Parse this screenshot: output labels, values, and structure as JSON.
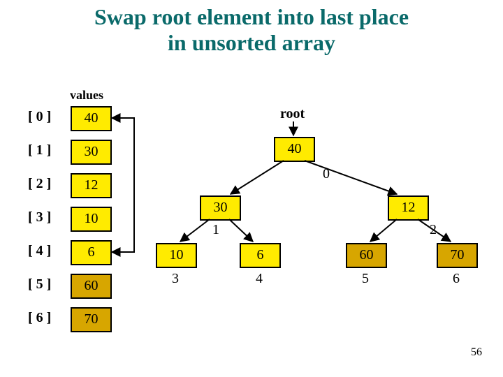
{
  "title_line1": "Swap root element into last place",
  "title_line2": "in unsorted array",
  "values_label": "values",
  "indices": [
    "[ 0 ]",
    "[ 1 ]",
    "[ 2 ]",
    "[ 3 ]",
    "[ 4 ]",
    "[ 5 ]",
    "[ 6 ]"
  ],
  "cells": [
    "40",
    "30",
    "12",
    "10",
    "6",
    "60",
    "70"
  ],
  "root_label": "root",
  "tree": {
    "n0": {
      "value": "40",
      "idx": "0"
    },
    "n1": {
      "value": "30",
      "idx": "1"
    },
    "n2": {
      "value": "12",
      "idx": "2"
    },
    "n3": {
      "value": "10",
      "idx": "3"
    },
    "n4": {
      "value": "6",
      "idx": "4"
    },
    "n5": {
      "value": "60",
      "idx": "5"
    },
    "n6": {
      "value": "70",
      "idx": "6"
    }
  },
  "page_number": "56"
}
